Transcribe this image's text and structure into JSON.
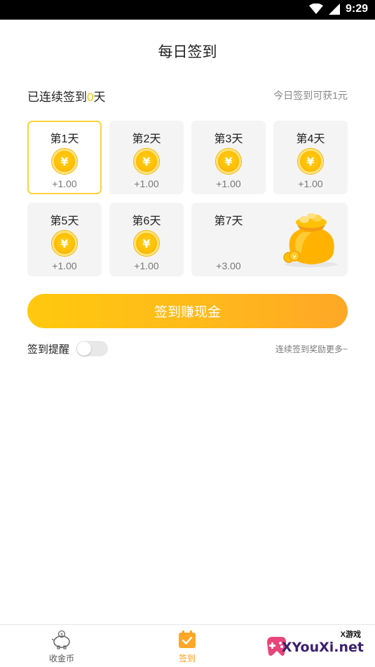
{
  "status_bar": {
    "time": "9:29",
    "icons": [
      "wifi-icon",
      "signal-icon"
    ]
  },
  "header": {
    "title": "每日签到"
  },
  "streak": {
    "prefix": "已连续签到",
    "count": "0",
    "suffix": "天",
    "today_reward": "今日签到可获1元"
  },
  "days": [
    {
      "label": "第1天",
      "amount": "+1.00",
      "icon": "coin-icon",
      "active": true
    },
    {
      "label": "第2天",
      "amount": "+1.00",
      "icon": "coin-icon",
      "active": false
    },
    {
      "label": "第3天",
      "amount": "+1.00",
      "icon": "coin-icon",
      "active": false
    },
    {
      "label": "第4天",
      "amount": "+1.00",
      "icon": "coin-icon",
      "active": false
    },
    {
      "label": "第5天",
      "amount": "+1.00",
      "icon": "coin-icon",
      "active": false
    },
    {
      "label": "第6天",
      "amount": "+1.00",
      "icon": "coin-icon",
      "active": false
    },
    {
      "label": "第7天",
      "amount": "+3.00",
      "icon": "money-bag-icon",
      "active": false
    }
  ],
  "coin_glyph": "¥",
  "checkin_button": {
    "label": "签到赚现金"
  },
  "reminder": {
    "label": "签到提醒",
    "enabled": false,
    "more_rewards": "连续签到奖励更多~"
  },
  "tab_bar": {
    "tabs": [
      {
        "label": "收金币",
        "icon": "piggy-bank-icon",
        "active": false
      },
      {
        "label": "签到",
        "icon": "calendar-check-icon",
        "active": true
      }
    ]
  },
  "watermark": {
    "small": "X游戏",
    "main": "XYouXi.net"
  },
  "colors": {
    "accent": "#ffc107",
    "button_start": "#ffc90e",
    "button_end": "#ffa726",
    "active_tab": "#ff9f1a"
  }
}
